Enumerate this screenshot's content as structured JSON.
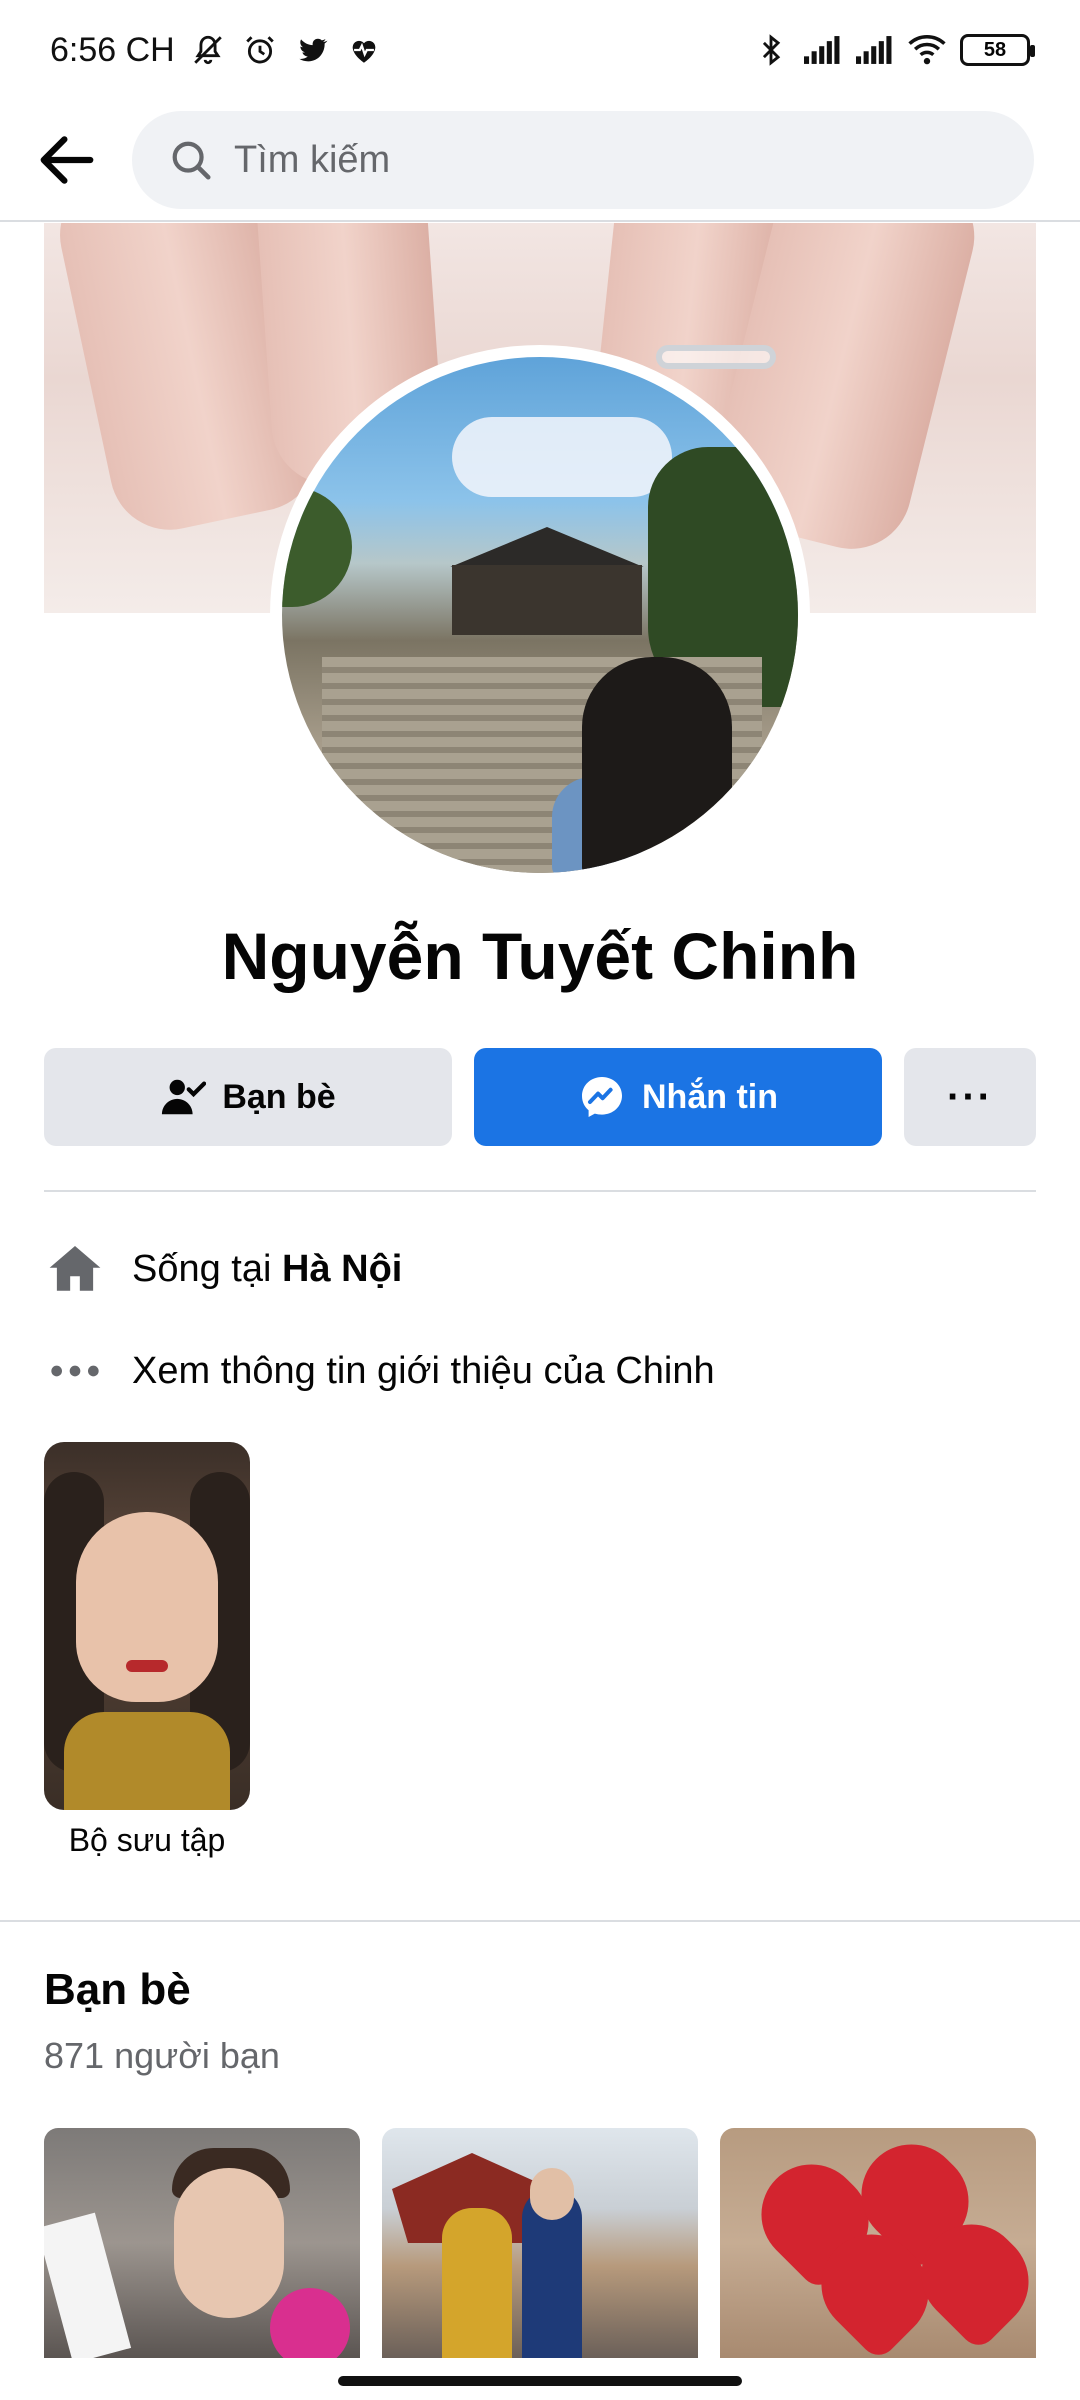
{
  "status_bar": {
    "time": "6:56 CH",
    "battery": "58",
    "left_icons": [
      "bell-off-icon",
      "alarm-icon",
      "twitter-icon",
      "heart-pulse-icon"
    ],
    "right_icons": [
      "bluetooth-icon",
      "signal-icon",
      "signal-icon",
      "wifi-icon",
      "battery-icon"
    ]
  },
  "search": {
    "placeholder": "Tìm kiếm"
  },
  "profile": {
    "name": "Nguyễn Tuyết Chinh"
  },
  "actions": {
    "friends_label": "Bạn bè",
    "message_label": "Nhắn tin",
    "more_label": "···"
  },
  "intro": {
    "lives_prefix": "Sống tại ",
    "lives_city": "Hà Nội",
    "see_about": "Xem thông tin giới thiệu của Chinh"
  },
  "featured": {
    "label": "Bộ sưu tập"
  },
  "friends": {
    "title": "Bạn bè",
    "count": "871 người bạn"
  },
  "colors": {
    "accent": "#1b74e4",
    "button_gray": "#e4e6eb",
    "secondary_text": "#65676b"
  }
}
